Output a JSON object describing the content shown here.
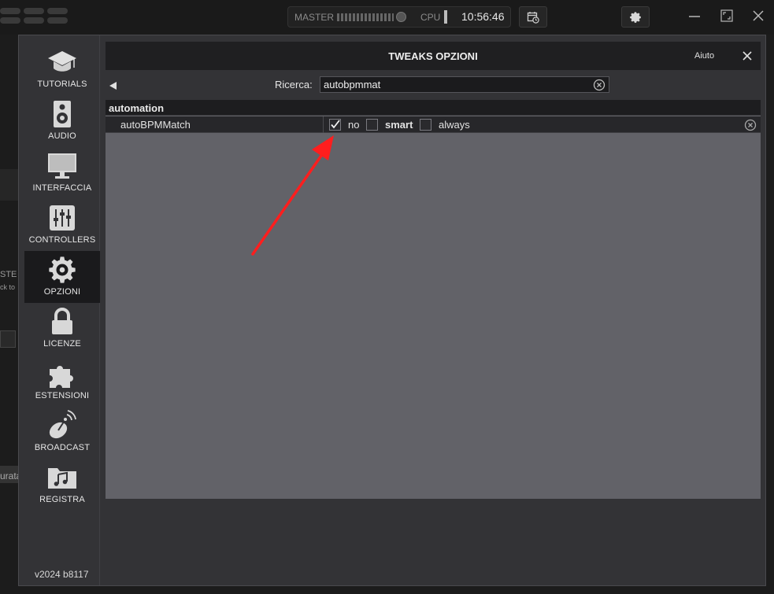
{
  "topbar": {
    "master_label": "MASTER",
    "cpu_label": "CPU",
    "clock": "10:56:46"
  },
  "background": {
    "frag_1": "STE",
    "frag_2": "ck to",
    "frag_3": "urata"
  },
  "dialog": {
    "title": "TWEAKS OPZIONI",
    "help_label": "Aiuto",
    "search_label": "Ricerca:",
    "search_value": "autobpmmat",
    "version": "v2024 b8117"
  },
  "sidebar": {
    "items": [
      {
        "label": "TUTORIALS",
        "icon": "graduation-cap-icon",
        "active": false
      },
      {
        "label": "AUDIO",
        "icon": "speaker-icon",
        "active": false
      },
      {
        "label": "INTERFACCIA",
        "icon": "monitor-icon",
        "active": false
      },
      {
        "label": "CONTROLLERS",
        "icon": "sliders-icon",
        "active": false
      },
      {
        "label": "OPZIONI",
        "icon": "gear-icon",
        "active": true
      },
      {
        "label": "LICENZE",
        "icon": "lock-icon",
        "active": false
      },
      {
        "label": "ESTENSIONI",
        "icon": "puzzle-icon",
        "active": false
      },
      {
        "label": "BROADCAST",
        "icon": "satellite-dish-icon",
        "active": false
      },
      {
        "label": "REGISTRA",
        "icon": "music-folder-icon",
        "active": false
      }
    ]
  },
  "results": {
    "category": "automation",
    "option": {
      "name": "autoBPMMatch",
      "choices": [
        {
          "label": "no",
          "checked": true
        },
        {
          "label": "smart",
          "checked": false
        },
        {
          "label": "always",
          "checked": false
        }
      ]
    }
  },
  "colors": {
    "accent_arrow": "#ff1e1e",
    "panel_bg": "#626268",
    "dialog_bg": "#333336"
  }
}
